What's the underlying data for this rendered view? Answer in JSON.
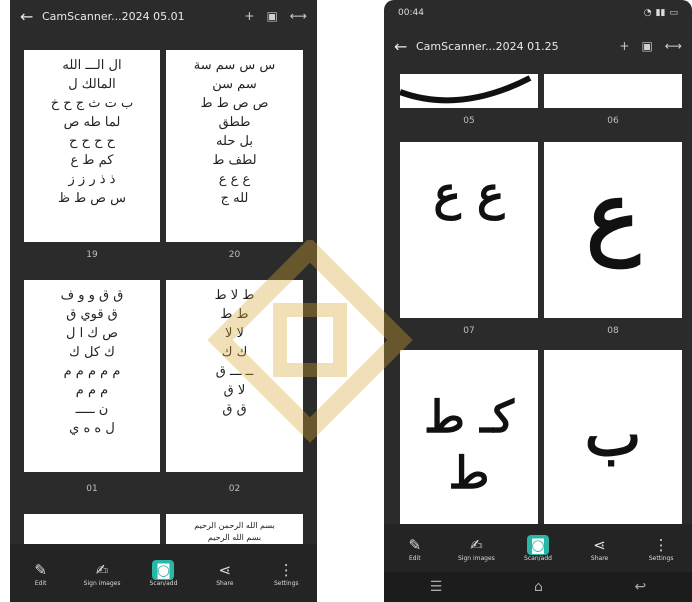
{
  "left": {
    "title": "CamScanner...2024 05.01",
    "pages": [
      {
        "label": "19",
        "lines": [
          "ال الـــ الله",
          "المالك ل",
          "ب ت ث ج ح خ",
          "لما طه ص",
          "ح ح ح ح",
          "كم ط ع",
          "ذ ذ ر ز ز",
          "س ص ط ظ"
        ]
      },
      {
        "label": "20",
        "lines": [
          "س س سم سة",
          "سم سن",
          "ص ص ط ط",
          "ططق",
          "بل حله",
          "لطف ط",
          "ع ع ع",
          "لله ج"
        ]
      },
      {
        "label": "01",
        "lines": [
          "ق ق و و ف",
          "ق قوي ق",
          "ص ك ا ل",
          "ك كل ك",
          "م م م م م",
          "م م م",
          "ن ـــــ",
          "ل ه ه ي"
        ]
      },
      {
        "label": "02",
        "lines": [
          "ط لا ط",
          "ط ط",
          "لا لا",
          "ك ك",
          "ــ ـــ ق",
          "لا ق",
          "ق ق"
        ]
      },
      {
        "label": "",
        "lines": []
      },
      {
        "label": "",
        "lines": [
          "بسم الله الرحمن الرحيم",
          "بسم الله الرحيم"
        ]
      }
    ]
  },
  "right": {
    "status_time": "00:44",
    "title": "CamScanner...2024 01.25",
    "pages": [
      {
        "label": "05"
      },
      {
        "label": "06"
      },
      {
        "label": "07",
        "glyph": "ع ع"
      },
      {
        "label": "08",
        "glyph": "ع"
      },
      {
        "label": "",
        "glyph": "كـ ط ط"
      },
      {
        "label": "",
        "glyph": "ب"
      }
    ]
  },
  "toolbar": {
    "items": [
      {
        "label": "Edit",
        "icon": "edit-icon"
      },
      {
        "label": "Sign images",
        "icon": "signature-icon"
      },
      {
        "label": "Scan/add",
        "icon": "camera-icon"
      },
      {
        "label": "Share",
        "icon": "share-icon"
      },
      {
        "label": "Settings",
        "icon": "more-icon"
      }
    ]
  }
}
